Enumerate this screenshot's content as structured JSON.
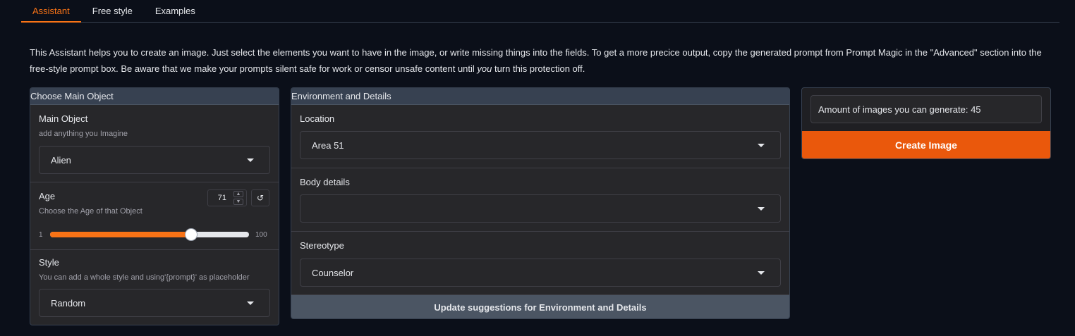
{
  "tabs": [
    "Assistant",
    "Free style",
    "Examples"
  ],
  "description": {
    "part1": "This Assistant helps you to create an image. Just select the elements you want to have in the image, or write missing things into the fields. To get a more precice output, copy the generated prompt from Prompt Magic in the \"Advanced\" section into the free-style prompt box. Be aware that we make your prompts silent safe for work or censor unsafe content until ",
    "emphasis": "you",
    "part2": " turn this protection off."
  },
  "main_object_panel": {
    "title": "Choose Main Object",
    "main_object": {
      "label": "Main Object",
      "info": "add anything you Imagine",
      "value": "Alien"
    },
    "age": {
      "label": "Age",
      "info": "Choose the Age of that Object",
      "value": "71",
      "min": "1",
      "max": "100",
      "level": 0.71,
      "reset_icon": "↺"
    },
    "style": {
      "label": "Style",
      "info": "You can add a whole style and using'{prompt}' as placeholder",
      "value": "Random"
    }
  },
  "environment_panel": {
    "title": "Environment and Details",
    "location": {
      "label": "Location",
      "value": "Area 51"
    },
    "body_details": {
      "label": "Body details",
      "value": ""
    },
    "stereotype": {
      "label": "Stereotype",
      "value": "Counselor"
    },
    "update_button": "Update suggestions for Environment and Details"
  },
  "generate_panel": {
    "counter": "Amount of images you can generate: 45",
    "create_button": "Create Image"
  },
  "colors": {
    "accent": "#f97316",
    "create_button": "#ea580c",
    "background": "#0b0f19"
  },
  "icons": {
    "dropdown": "chevron-down-icon",
    "reset": "reset-icon",
    "spin_up": "caret-up-icon",
    "spin_down": "caret-down-icon"
  }
}
